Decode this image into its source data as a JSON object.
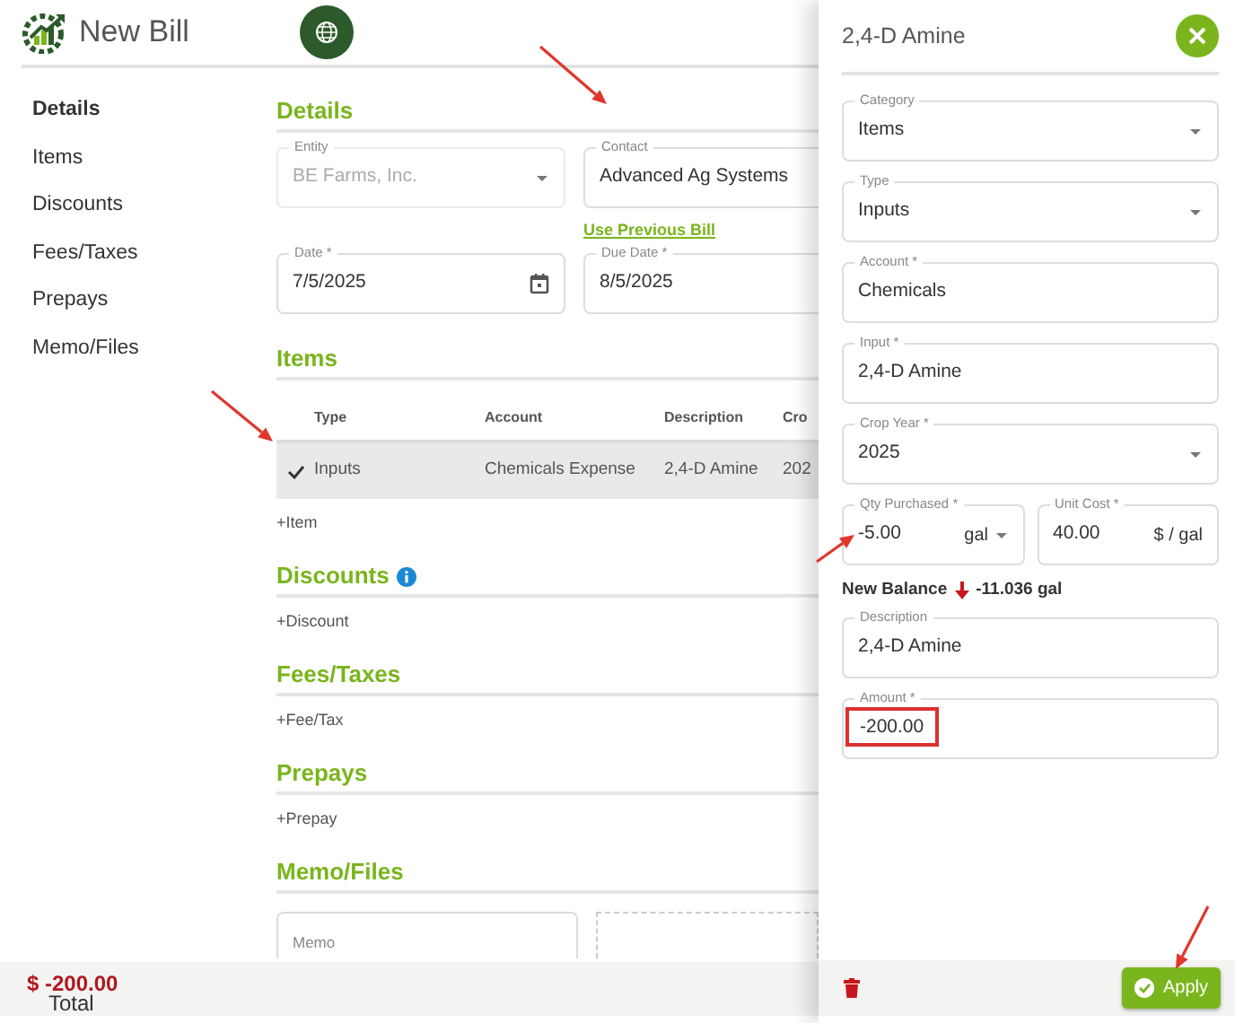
{
  "header": {
    "title": "New Bill"
  },
  "sidebar": {
    "items": [
      {
        "label": "Details",
        "selected": true
      },
      {
        "label": "Items",
        "selected": false
      },
      {
        "label": "Discounts",
        "selected": false
      },
      {
        "label": "Fees/Taxes",
        "selected": false
      },
      {
        "label": "Prepays",
        "selected": false
      },
      {
        "label": "Memo/Files",
        "selected": false
      }
    ]
  },
  "details": {
    "heading": "Details",
    "fields": [
      {
        "label": "Entity",
        "value": "BE Farms, Inc.",
        "kind": "select",
        "disabled": true
      },
      {
        "label": "Contact",
        "value": "Advanced Ag Systems",
        "disabled": false
      }
    ],
    "link": "Use Previous Bill",
    "dates": [
      {
        "label": "Date *",
        "value": "7/5/2025",
        "kind": "date",
        "disabled": false
      },
      {
        "label": "Due Date *",
        "value": "8/5/2025",
        "disabled": false
      }
    ]
  },
  "items": {
    "heading": "Items",
    "columns": [
      "Type",
      "Account",
      "Description",
      "Cro"
    ],
    "rows": [
      {
        "checked": true,
        "selected": true,
        "cells": [
          "Inputs",
          "Chemicals Expense",
          "2,4-D Amine",
          "202"
        ]
      }
    ],
    "add": "+Item"
  },
  "sections": [
    {
      "heading": "Discounts",
      "info": true,
      "add": "+Discount"
    },
    {
      "heading": "Fees/Taxes",
      "add": "+Fee/Tax"
    },
    {
      "heading": "Prepays",
      "add": "+Prepay"
    }
  ],
  "memo": {
    "heading": "Memo/Files",
    "placeholder": "Memo"
  },
  "footer": {
    "total": "$ -200.00",
    "label": "Total"
  },
  "drawer": {
    "title": "2,4-D Amine",
    "rows_top": [
      [
        {
          "label": "Category",
          "value": "Items",
          "kind": "select"
        }
      ],
      [
        {
          "label": "Type",
          "value": "Inputs",
          "kind": "select"
        }
      ],
      [
        {
          "label": "Account *",
          "value": "Chemicals"
        }
      ],
      [
        {
          "label": "Input *",
          "value": "2,4-D Amine"
        }
      ],
      [
        {
          "label": "Crop Year *",
          "value": "2025",
          "kind": "select"
        }
      ],
      [
        {
          "label": "Qty Purchased *",
          "value": "-5.00",
          "kind": "unit-select",
          "suffix": "gal"
        },
        {
          "label": "Unit Cost *",
          "value": "40.00",
          "suffix": "$ / gal"
        }
      ]
    ],
    "balance": {
      "label": "New Balance",
      "value": "-11.036 gal"
    },
    "rows_bottom": [
      [
        {
          "label": "Description",
          "value": "2,4-D Amine"
        }
      ],
      [
        {
          "label": "Amount *",
          "value": "-200.00",
          "highlighted": true
        }
      ]
    ],
    "apply": "Apply"
  }
}
